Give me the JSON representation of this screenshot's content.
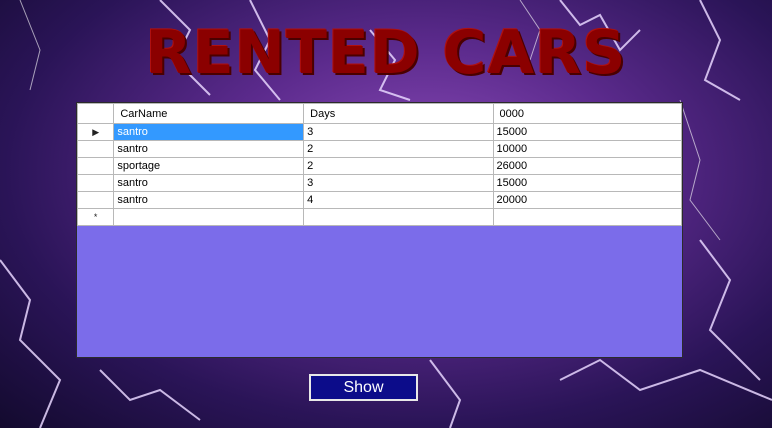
{
  "title": "RENTED CARS",
  "grid": {
    "columns": [
      "CarName",
      "Days",
      "0000"
    ],
    "rows": [
      [
        "santro",
        "3",
        "15000"
      ],
      [
        "santro",
        "2",
        "10000"
      ],
      [
        "sportage",
        "2",
        "26000"
      ],
      [
        "santro",
        "3",
        "15000"
      ],
      [
        "santro",
        "4",
        "20000"
      ]
    ],
    "current_row_glyph": "▶",
    "new_row_glyph": "*",
    "selected_row": 0,
    "selected_col": 0
  },
  "show_button": "Show"
}
